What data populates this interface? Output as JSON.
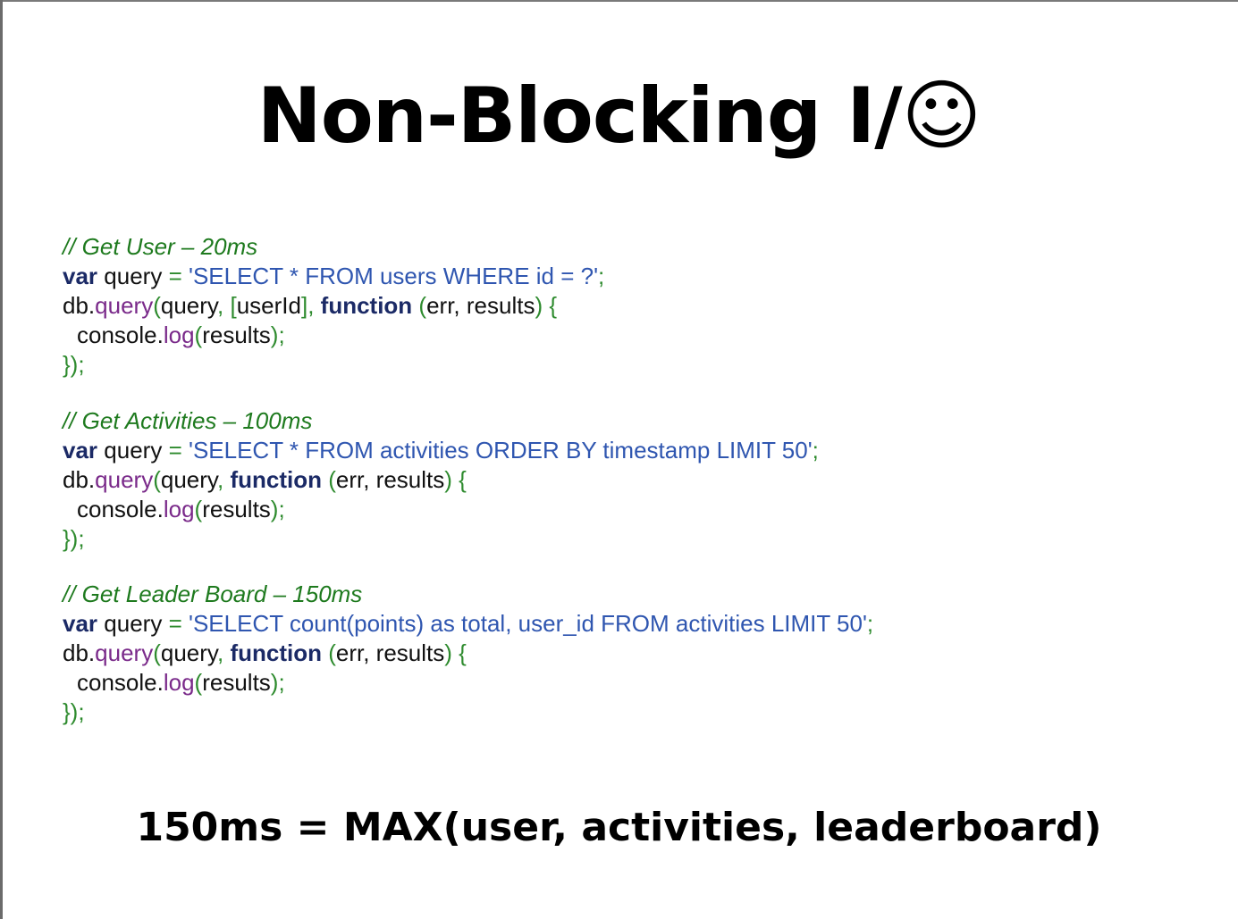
{
  "slide": {
    "title": "Non-Blocking I/☺",
    "summary": "150ms = MAX(user, activities, leaderboard)"
  },
  "blocks": [
    {
      "comment": "// Get User – 20ms",
      "var_kw": "var",
      "query_var": "query",
      "assign": "=",
      "sql": "'SELECT * FROM users WHERE id = ?'",
      "semi": ";",
      "db": "db.",
      "query_method": "query",
      "open_paren": "(",
      "arg_query": "query",
      "comma1": ",",
      "params_open": "[",
      "params_value": "userId",
      "params_close": "]",
      "comma2": ",",
      "function_kw": "function",
      "fn_open": "(",
      "fn_args": "err, results",
      "fn_close": ") {",
      "console": "console.",
      "log_method": "log",
      "log_open": "(",
      "log_arg": "results",
      "log_close": ");",
      "closing": "});"
    },
    {
      "comment": "// Get Activities – 100ms",
      "var_kw": "var",
      "query_var": "query",
      "assign": "=",
      "sql": "'SELECT * FROM activities ORDER BY timestamp LIMIT 50'",
      "semi": ";",
      "db": "db.",
      "query_method": "query",
      "open_paren": "(",
      "arg_query": "query",
      "comma2": ",",
      "function_kw": "function",
      "fn_open": "(",
      "fn_args": "err, results",
      "fn_close": ") {",
      "console": "console.",
      "log_method": "log",
      "log_open": "(",
      "log_arg": "results",
      "log_close": ");",
      "closing": "});"
    },
    {
      "comment": "// Get Leader Board – 150ms",
      "var_kw": "var",
      "query_var": "query",
      "assign": "=",
      "sql": "'SELECT count(points) as total, user_id FROM activities LIMIT 50'",
      "semi": ";",
      "db": "db.",
      "query_method": "query",
      "open_paren": "(",
      "arg_query": "query",
      "comma2": ",",
      "function_kw": "function",
      "fn_open": "(",
      "fn_args": "err, results",
      "fn_close": ") {",
      "console": "console.",
      "log_method": "log",
      "log_open": "(",
      "log_arg": "results",
      "log_close": ");",
      "closing": "});"
    }
  ]
}
